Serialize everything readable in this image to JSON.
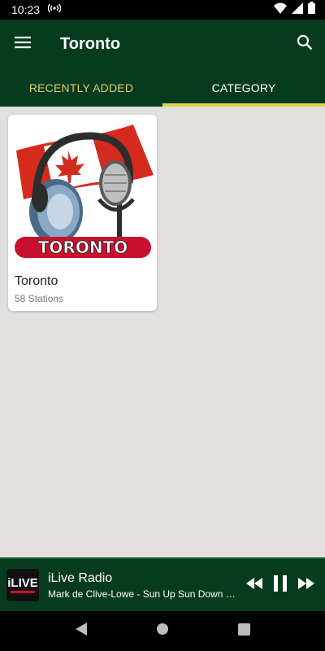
{
  "status_bar": {
    "time": "10:23",
    "icons": [
      "radio-broadcast-icon",
      "wifi-icon",
      "signal-icon",
      "battery-icon"
    ]
  },
  "app_bar": {
    "title": "Toronto",
    "menu_icon": "hamburger-menu-icon",
    "search_icon": "search-icon"
  },
  "tabs": [
    {
      "label": "Recently Added",
      "active": false
    },
    {
      "label": "Category",
      "active": true
    }
  ],
  "categories": [
    {
      "art_text": "TORONTO",
      "name": "Toronto",
      "count": "58 Stations"
    }
  ],
  "player": {
    "logo_text": "iLIVE",
    "station": "iLive Radio",
    "track": "Mark de Clive-Lowe - Sun Up Sun Down fe...",
    "controls": [
      "rewind-icon",
      "pause-icon",
      "fast-forward-icon"
    ]
  },
  "nav": [
    "back-icon",
    "home-icon",
    "recents-icon"
  ],
  "colors": {
    "primary": "#073b1f",
    "tab_indicator": "#e1d44a",
    "tab_inactive_text": "#d8cd70",
    "background": "#e2dfdf",
    "flag_red": "#d52b1e"
  }
}
